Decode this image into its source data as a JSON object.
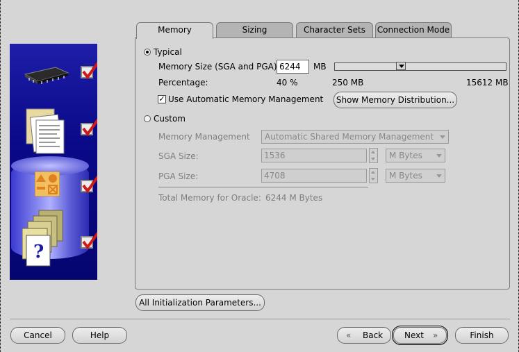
{
  "tabs": [
    {
      "label": "Memory",
      "active": true
    },
    {
      "label": "Sizing",
      "active": false
    },
    {
      "label": "Character Sets",
      "active": false
    },
    {
      "label": "Connection Mode",
      "active": false
    }
  ],
  "typical": {
    "label": "Typical",
    "selected": true,
    "memory_size_label": "Memory Size (SGA and PGA):",
    "memory_size_value": "6244",
    "memory_unit": "MB",
    "percentage_label": "Percentage:",
    "percentage_value": "40 %",
    "slider_min": "250 MB",
    "slider_max": "15612 MB",
    "auto_mem_label": "Use Automatic Memory Management",
    "auto_mem_checked": true,
    "show_dist_button": "Show Memory Distribution..."
  },
  "custom": {
    "label": "Custom",
    "selected": false,
    "mem_mgmt_label": "Memory Management",
    "mem_mgmt_value": "Automatic Shared Memory Management",
    "sga_label": "SGA Size:",
    "sga_value": "1536",
    "sga_unit": "M Bytes",
    "pga_label": "PGA Size:",
    "pga_value": "4708",
    "pga_unit": "M Bytes",
    "total_label": "Total Memory for Oracle:",
    "total_value": "6244 M Bytes"
  },
  "all_init_params_button": "All Initialization Parameters...",
  "footer": {
    "cancel": "Cancel",
    "help": "Help",
    "back": "Back",
    "next": "Next",
    "finish": "Finish"
  },
  "icons": [
    "chip-icon",
    "documents-icon",
    "shapes-icon",
    "folders-question-icon",
    "checkmark-icon"
  ]
}
